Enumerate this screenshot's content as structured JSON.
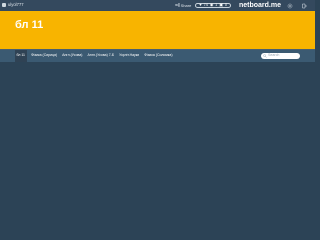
{
  "topbar": {
    "username": "ulyol777",
    "share_label": "Share",
    "stats_left": "74",
    "stats_mid": "1",
    "stats_right": "0",
    "brand": "netboard.me"
  },
  "hero": {
    "title": "бл 11"
  },
  "nav": {
    "items": [
      {
        "label": "бл 11"
      },
      {
        "label": "Фізика (Сириця)"
      },
      {
        "label": "Англ.(Усова)"
      },
      {
        "label": "Англ.(Усова) 7-Б"
      },
      {
        "label": "Укрліт.Науки"
      },
      {
        "label": "Фізика (Соломка)"
      }
    ],
    "search_placeholder": "Search"
  }
}
